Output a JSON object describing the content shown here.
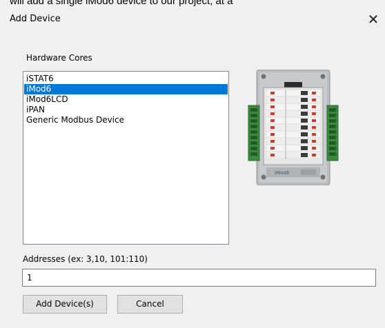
{
  "background_text": "will add a single iMod6 device to our project, at a",
  "dialog": {
    "title": "Add Device",
    "close_glyph": "✕"
  },
  "hardware": {
    "label": "Hardware Cores",
    "items": [
      {
        "label": "iSTAT6",
        "selected": false
      },
      {
        "label": "iMod6",
        "selected": true
      },
      {
        "label": "iMod6LCD",
        "selected": false
      },
      {
        "label": "iPAN",
        "selected": false
      },
      {
        "label": "Generic Modbus Device",
        "selected": false
      }
    ]
  },
  "device_image": {
    "icon": "imod6-device-image",
    "badge": "iMod6"
  },
  "addresses": {
    "label": "Addresses (ex: 3,10, 101:110)",
    "value": "1"
  },
  "buttons": {
    "add": "Add Device(s)",
    "cancel": "Cancel"
  },
  "colors": {
    "selection": "#0078d7",
    "window": "#f0f0f0"
  }
}
